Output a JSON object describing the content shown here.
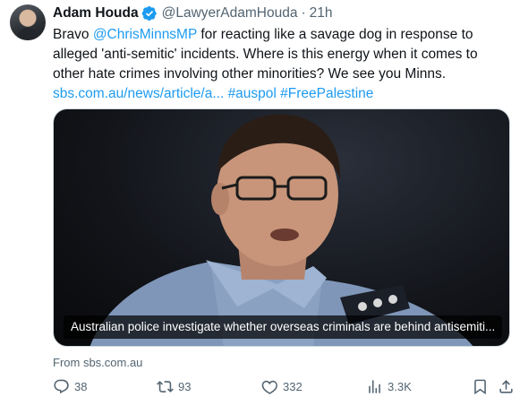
{
  "author": {
    "name": "Adam Houda",
    "handle": "@LawyerAdamHouda",
    "separator": "·",
    "time": "21h"
  },
  "tweet": {
    "text_before": "Bravo ",
    "mention": "@ChrisMinnsMP",
    "text_middle": " for reacting like a savage dog in response to alleged 'anti-semitic' incidents. Where is this energy when it comes to other hate crimes involving other minorities? We see you Minns. ",
    "link": "sbs.com.au/news/article/a...",
    "hashtag_1": "#auspol",
    "hashtag_2": "#FreePalestine"
  },
  "card": {
    "caption": "Australian police investigate whether overseas criminals are behind antisemiti...",
    "source": "From sbs.com.au"
  },
  "actions": {
    "replies": "38",
    "retweets": "93",
    "likes": "332",
    "views": "3.3K"
  },
  "icons": [
    "verified-badge-icon",
    "reply-icon",
    "retweet-icon",
    "like-icon",
    "views-icon",
    "bookmark-icon",
    "share-icon"
  ],
  "colors": {
    "link": "#1d9bf0",
    "text": "#0f1419",
    "secondary": "#536471",
    "border": "#cfd9de"
  }
}
